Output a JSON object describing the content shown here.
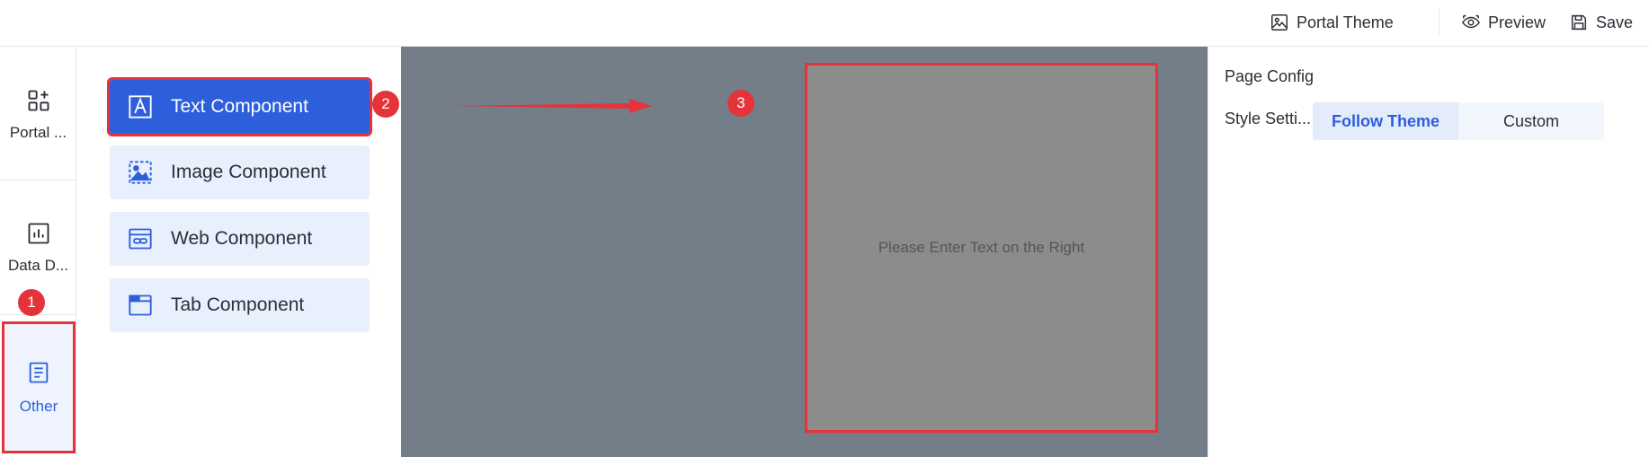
{
  "topbar": {
    "portal_theme": "Portal Theme",
    "preview": "Preview",
    "save": "Save"
  },
  "leftnav": {
    "items": [
      {
        "label": "Portal ...",
        "icon": "add-grid-icon"
      },
      {
        "label": "Data D...",
        "icon": "bar-chart-icon"
      },
      {
        "label": "Other",
        "icon": "document-icon"
      }
    ]
  },
  "components": [
    {
      "label": "Text Component",
      "icon": "text-icon",
      "active": true
    },
    {
      "label": "Image Component",
      "icon": "image-icon"
    },
    {
      "label": "Web Component",
      "icon": "web-link-icon"
    },
    {
      "label": "Tab Component",
      "icon": "tab-icon"
    }
  ],
  "canvas": {
    "placeholder": "Please Enter Text on the Right"
  },
  "config": {
    "title": "Page Config",
    "style_label": "Style Setti...",
    "options": [
      "Follow Theme",
      "Custom"
    ]
  },
  "annotations": {
    "badges": [
      "1",
      "2",
      "3"
    ],
    "color": "#e5333a"
  },
  "colors": {
    "accent": "#2d5fdc",
    "canvas": "#747e89",
    "highlight": "#e5333a"
  }
}
